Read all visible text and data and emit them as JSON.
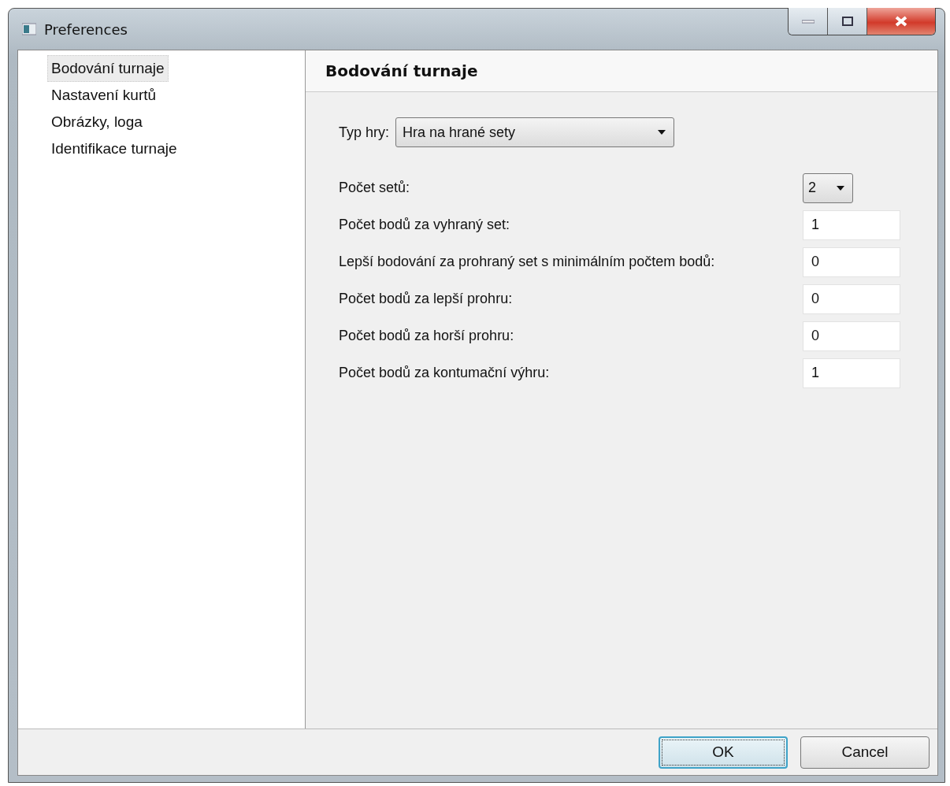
{
  "window": {
    "title": "Preferences"
  },
  "sidebar": {
    "items": [
      {
        "label": "Bodování turnaje",
        "selected": true
      },
      {
        "label": "Nastavení kurtů",
        "selected": false
      },
      {
        "label": "Obrázky, loga",
        "selected": false
      },
      {
        "label": "Identifikace turnaje",
        "selected": false
      }
    ]
  },
  "panel": {
    "heading": "Bodování turnaje",
    "game_type": {
      "label": "Typ hry:",
      "value": "Hra na hrané sety"
    },
    "settings": [
      {
        "kind": "select",
        "label": "Počet setů:",
        "value": "2"
      },
      {
        "kind": "text",
        "label": "Počet bodů za vyhraný set:",
        "value": "1"
      },
      {
        "kind": "text",
        "label": "Lepší bodování za prohraný set s minimálním počtem bodů:",
        "value": "0"
      },
      {
        "kind": "text",
        "label": "Počet bodů za lepší prohru:",
        "value": "0"
      },
      {
        "kind": "text",
        "label": "Počet bodů za horší prohru:",
        "value": "0"
      },
      {
        "kind": "text",
        "label": "Počet bodů za kontumační výhru:",
        "value": "1"
      }
    ]
  },
  "buttons": [
    {
      "label": "OK",
      "default": true
    },
    {
      "label": "Cancel",
      "default": false
    }
  ]
}
